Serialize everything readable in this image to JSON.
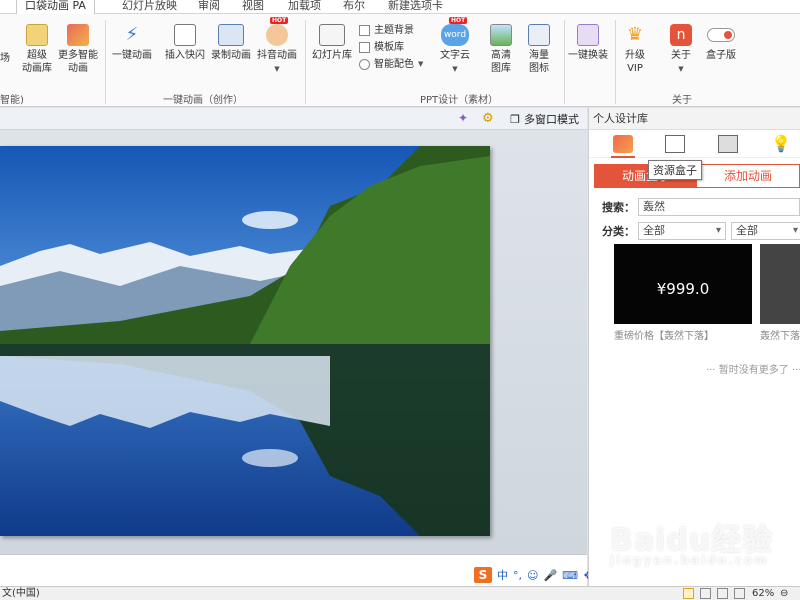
{
  "tabs": [
    "口袋动画 PA",
    "幻灯片放映",
    "审阅",
    "视图",
    "加载项",
    "布尔",
    "新建选项卡"
  ],
  "ribbon": {
    "left_partial": {
      "label1": "场",
      "group_label": "智能)"
    },
    "buttons": {
      "super_lib": "超级\n动画库",
      "more_smart": "更多智能\n动画",
      "one_key_anim": "一键动画",
      "insert_flash": "插入快闪",
      "record_anim": "录制动画",
      "douyin_anim": "抖音动画",
      "slide_lib": "幻灯片库",
      "wordcloud": "文字云",
      "hd_images": "高清\n图库",
      "mass_icons": "海量\n图标",
      "one_key_skin": "一键换装",
      "upgrade_vip": "升级\nVIP",
      "about": "关于",
      "box_version": "盒子版"
    },
    "small_items": [
      "主题背景",
      "模板库",
      "智能配色"
    ],
    "hot_badge": "HOT",
    "group_labels": {
      "anim": "一键动画（创作）",
      "ppt": "PPT设计（素材）",
      "about": "关于"
    }
  },
  "slide_toolbar": {
    "multi_window": "多窗口模式"
  },
  "panel": {
    "title": "个人设计库",
    "tooltip": "资源盒子",
    "seg_tabs": [
      "动画盒子",
      "添加动画"
    ],
    "search_label": "搜索：",
    "search_value": "轰然",
    "category_label": "分类：",
    "category_values": [
      "全部",
      "全部"
    ],
    "card_price": "¥999.0",
    "card_captions": [
      "重磅价格【轰然下落】",
      "轰然下落"
    ],
    "no_more": "··· 暂时没有更多了 ···"
  },
  "ime": {
    "logo": "S",
    "lang": "中",
    "punct": "°,"
  },
  "statusbar": {
    "lang": "文(中国)",
    "zoom": "62%"
  },
  "watermark": {
    "brand": "Baidu经验",
    "sub": "jingyan.baidu.com"
  },
  "colors": {
    "accent": "#e4543a",
    "ribbon_bg": "#fafafa"
  }
}
